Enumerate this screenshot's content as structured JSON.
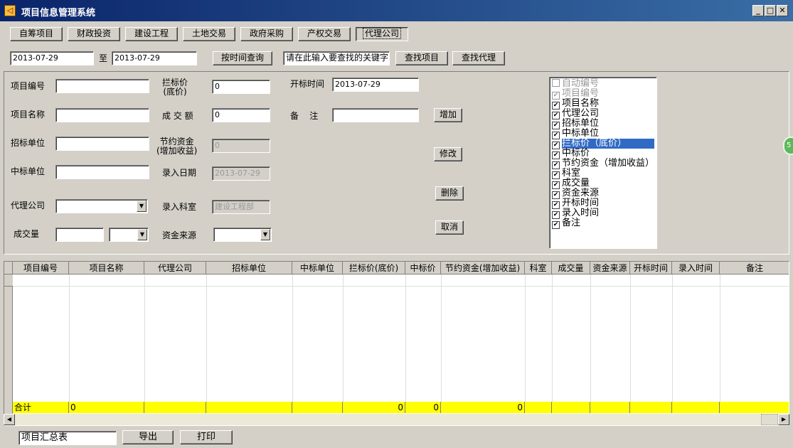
{
  "window": {
    "title": "项目信息管理系统",
    "icon": "app-logo-icon",
    "controls": [
      "minimize",
      "maximize",
      "close"
    ]
  },
  "tabs": [
    {
      "label": "自筹项目"
    },
    {
      "label": "财政投资"
    },
    {
      "label": "建设工程"
    },
    {
      "label": "土地交易"
    },
    {
      "label": "政府采购"
    },
    {
      "label": "产权交易"
    },
    {
      "label": "代理公司",
      "active": true
    }
  ],
  "search": {
    "date_from": "2013-07-29",
    "to_label": "至",
    "date_to": "2013-07-29",
    "time_query_button": "按时间查询",
    "keyword_placeholder": "请在此输入要查找的关键字",
    "find_project_button": "查找项目",
    "find_agent_button": "查找代理"
  },
  "form": {
    "project_no": {
      "label": "项目编号",
      "value": ""
    },
    "project_name": {
      "label": "项目名称",
      "value": ""
    },
    "tender_unit": {
      "label": "招标单位",
      "value": ""
    },
    "winner_unit": {
      "label": "中标单位",
      "value": ""
    },
    "agent_company": {
      "label": "代理公司",
      "value": ""
    },
    "deal_volume": {
      "label": "成交量",
      "value": "",
      "unit": ""
    },
    "ceiling_price": {
      "label_l1": "拦标价",
      "label_l2": "(底价)",
      "value": "0"
    },
    "deal_amount": {
      "label": "成 交 额",
      "value": "0"
    },
    "savings": {
      "label_l1": "节约资金",
      "label_l2": "(增加收益)",
      "value": "0"
    },
    "entry_date": {
      "label": "录入日期",
      "value": "2013-07-29"
    },
    "entry_dept": {
      "label": "录入科室",
      "value": "建设工程部"
    },
    "fund_source": {
      "label": "资金来源",
      "value": ""
    },
    "open_time": {
      "label": "开标时间",
      "value": "2013-07-29"
    },
    "remarks": {
      "label": "备    注",
      "value": ""
    }
  },
  "actions": {
    "add": "增加",
    "edit": "修改",
    "delete": "删除",
    "cancel": "取消"
  },
  "columns_list": [
    {
      "label": "自动编号",
      "checked": false,
      "disabled": true
    },
    {
      "label": "项目编号",
      "checked": true,
      "disabled": true
    },
    {
      "label": "项目名称",
      "checked": true
    },
    {
      "label": "代理公司",
      "checked": true
    },
    {
      "label": "招标单位",
      "checked": true
    },
    {
      "label": "中标单位",
      "checked": true
    },
    {
      "label": "拦标价（底价）",
      "checked": true,
      "selected": true
    },
    {
      "label": "中标价",
      "checked": true
    },
    {
      "label": "节约资金（增加收益）",
      "checked": true
    },
    {
      "label": "科室",
      "checked": true
    },
    {
      "label": "成交量",
      "checked": true
    },
    {
      "label": "资金来源",
      "checked": true
    },
    {
      "label": "开标时间",
      "checked": true
    },
    {
      "label": "录入时间",
      "checked": true
    },
    {
      "label": "备注",
      "checked": true
    }
  ],
  "grid": {
    "headers": [
      "项目编号",
      "项目名称",
      "代理公司",
      "招标单位",
      "中标单位",
      "拦标价(底价)",
      "中标价",
      "节约资金(增加收益)",
      "科室",
      "成交量",
      "资金来源",
      "开标时间",
      "录入时间",
      "备注"
    ],
    "total_row": {
      "label": "合计",
      "project_name": "0",
      "ceiling_price": "0",
      "winning_price": "0",
      "savings": "0"
    }
  },
  "footer": {
    "report_name": "项目汇总表",
    "export_button": "导出",
    "print_button": "打印"
  },
  "side_badge": "5"
}
